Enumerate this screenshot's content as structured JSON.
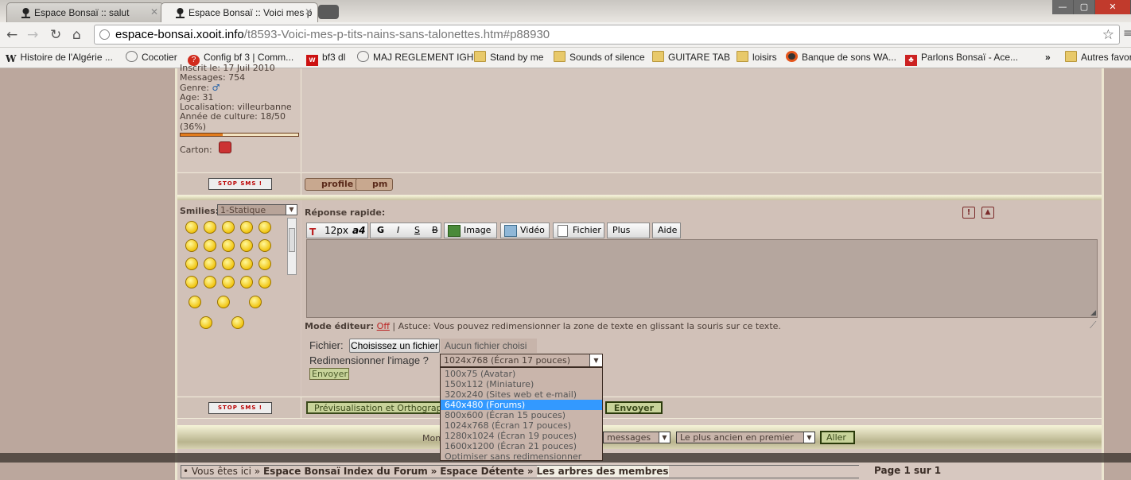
{
  "browser": {
    "tabs": [
      {
        "label": "Espace Bonsaï :: salut",
        "active": false
      },
      {
        "label": "Espace Bonsaï :: Voici mes p",
        "active": true
      }
    ],
    "window_controls": [
      "—",
      "▢",
      "✕"
    ],
    "address": {
      "host": "espace-bonsai.xooit.info",
      "path": "/t8593-Voici-mes-p-tits-nains-sans-talonettes.htm#p88930"
    },
    "bookmarks": [
      {
        "label": "Histoire de l'Algérie ...",
        "icon": "wikipedia-icon"
      },
      {
        "label": "Cocotier",
        "icon": "globe-icon"
      },
      {
        "label": "Config bf 3 | Comm...",
        "icon": "help-icon"
      },
      {
        "label": "bf3 dl",
        "icon": "w-icon"
      },
      {
        "label": "MAJ REGLEMENT IGH",
        "icon": "globe-icon"
      },
      {
        "label": "Stand by me",
        "icon": "folder-icon"
      },
      {
        "label": "Sounds of silence",
        "icon": "folder-icon"
      },
      {
        "label": "GUITARE TAB",
        "icon": "folder-icon"
      },
      {
        "label": "loisirs",
        "icon": "folder-icon"
      },
      {
        "label": "Banque de sons WA...",
        "icon": "record-icon"
      },
      {
        "label": "Parlons Bonsaï - Ace...",
        "icon": "bonsai-icon"
      }
    ],
    "bookmarks_overflow": "»",
    "other_bookmarks": "Autres favoris"
  },
  "profile": {
    "lines": [
      "Inscrit le: 17 Juil 2010",
      "Messages: 754",
      "Genre:",
      "Age: 31",
      "Localisation: villeurbanne",
      "Année de culture: 18/50",
      "(36%)"
    ],
    "culture_progress": 0.36,
    "carton_label": "Carton:",
    "stop_sms": "STOP SMS !",
    "profile_btn": "profile",
    "pm_btn": "pm"
  },
  "smilies": {
    "label": "Smilies:",
    "select_value": "1-Statique"
  },
  "reply": {
    "title": "Réponse rapide:",
    "toolbar": {
      "fontsize": "12px",
      "bold": "G",
      "italic": "I",
      "underline": "S",
      "strike": "B",
      "image": "Image",
      "video": "Vidéo",
      "file": "Fichier",
      "more": "Plus >>",
      "help": "Aide"
    },
    "mode_label": "Mode éditeur:",
    "mode_value": "Off",
    "tip": "| Astuce: Vous pouvez redimensionner la zone de texte en glissant la souris sur ce texte.",
    "file_label": "Fichier:",
    "choose_file": "Choisissez un fichier",
    "no_file": "Aucun fichier choisi",
    "resize_label": "Redimensionner l'image ?",
    "resize_value": "1024x768 (Écran 17 pouces)",
    "resize_options": [
      "100x75 (Avatar)",
      "150x112 (Miniature)",
      "320x240 (Sites web et e-mail)",
      "640x480 (Forums)",
      "800x600 (Écran 15 pouces)",
      "1024x768 (Écran 17 pouces)",
      "1280x1024 (Écran 19 pouces)",
      "1600x1200 (Écran 21 pouces)",
      "Optimiser sans redimensionner"
    ],
    "resize_selected_index": 3,
    "send_small": "Envoyer",
    "preview_btn": "Prévisualisation et Orthographe",
    "send_btn": "Envoyer"
  },
  "footer": {
    "display_label": "Mon",
    "messages_select": "messages",
    "order_select": "Le plus ancien en premier",
    "go_btn": "Aller",
    "breadcrumb_prefix": "• Vous êtes ici »",
    "breadcrumb": [
      "Espace Bonsaï Index du Forum",
      "Espace Détente",
      "Les arbres des membres"
    ],
    "breadcrumb_sep": "»",
    "page_info": "Page 1 sur 1"
  }
}
